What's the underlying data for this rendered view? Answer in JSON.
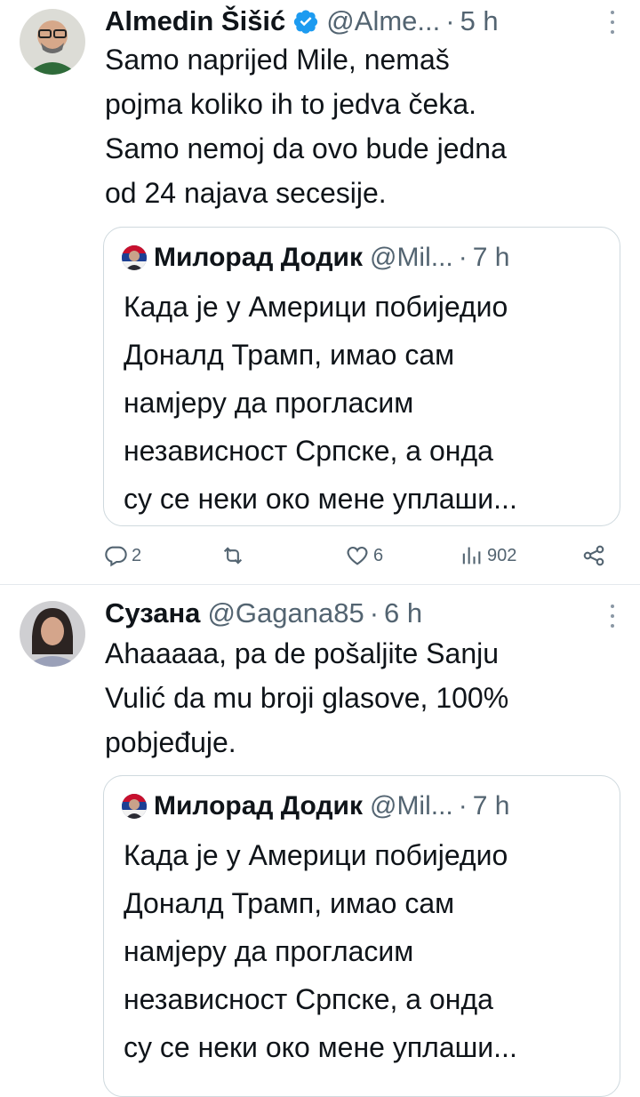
{
  "tweets": [
    {
      "name": "Almedin Šišić",
      "verified": true,
      "handle": "@Alme...",
      "time": "5 h",
      "text": "Samo naprijed Mile, nemaš\npojma koliko ih to jedva čeka.\nSamo nemoj da ovo bude jedna\nod 24 najava secesije.",
      "quote": {
        "name": "Милорад Додик",
        "handle": "@Mil...",
        "time": "7 h",
        "text": "Када је у Америци побиједио\nДоналд Трамп, имао сам\nнамјеру да прогласим\nнезависност Српске, а онда\nсу се неки око мене уплаши..."
      },
      "actions": {
        "replies": "2",
        "reposts": "",
        "likes": "6",
        "views": "902"
      }
    },
    {
      "name": "Сузана",
      "verified": false,
      "handle": "@Gagana85",
      "time": "6 h",
      "text": "Ahaaaaa, pa de pošaljite Sanju\nVulić da mu broji glasove, 100%\npobjeđuje.",
      "quote": {
        "name": "Милорад Додик",
        "handle": "@Mil...",
        "time": "7 h",
        "text": "Када је у Америци побиједио\nДоналд Трамп, имао сам\nнамјеру да прогласим\nнезависност Српске, а онда\nсу се неки око мене уплаши..."
      }
    }
  ],
  "separator": "·",
  "icons": {
    "verified": "verified-badge-icon",
    "more": "more-vertical-icon",
    "reply": "reply-icon",
    "repost": "repost-icon",
    "like": "like-icon",
    "views": "views-icon",
    "share": "share-icon"
  },
  "colors": {
    "text": "#0f1419",
    "muted": "#536471",
    "verified": "#1d9bf0",
    "border": "#cfd9de"
  }
}
